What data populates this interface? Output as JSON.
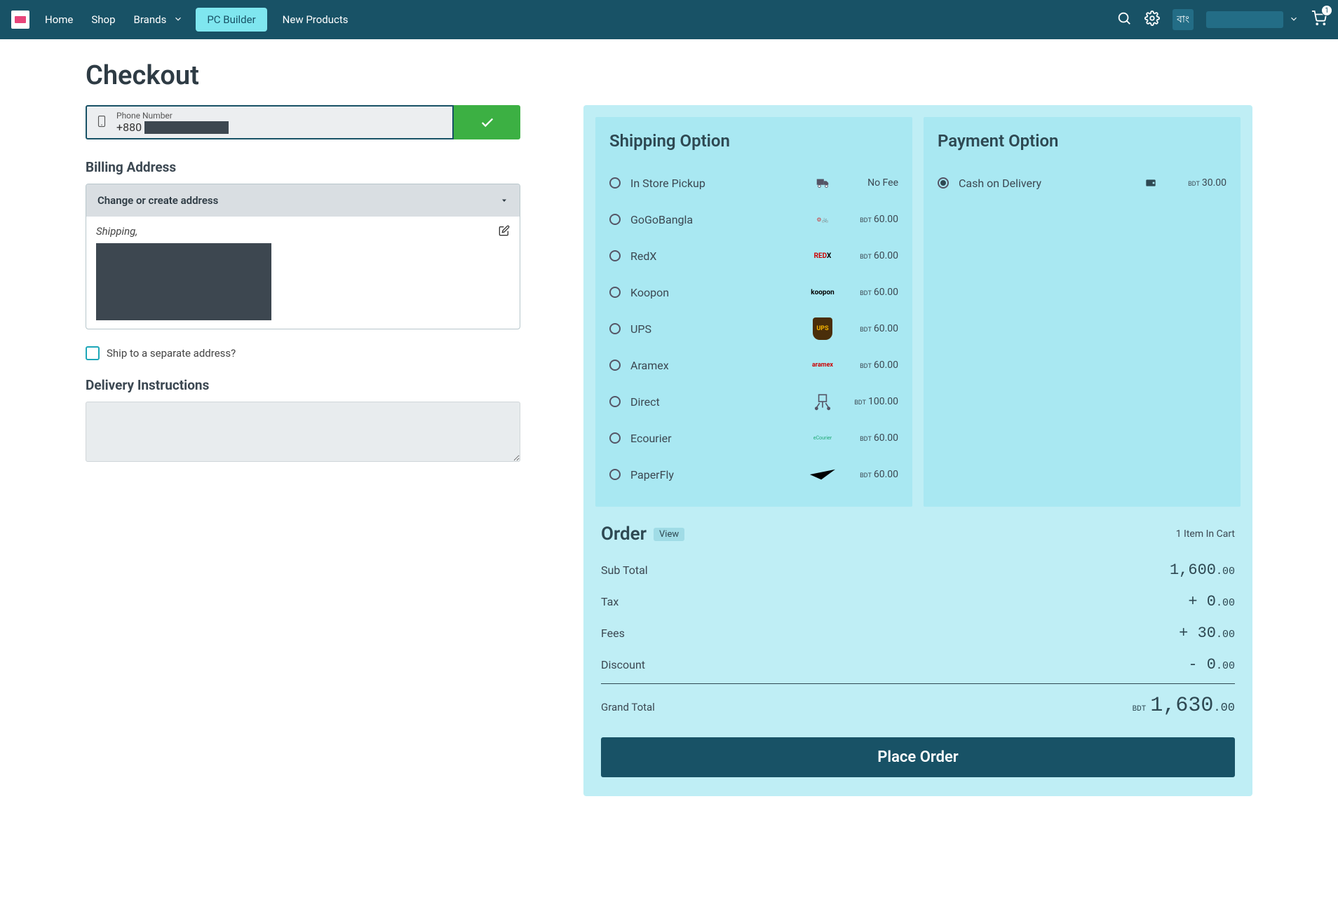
{
  "header": {
    "nav": {
      "home": "Home",
      "shop": "Shop",
      "brands": "Brands",
      "pc_builder": "PC Builder",
      "new_products": "New Products"
    },
    "lang": "বাং",
    "cart_count": "1"
  },
  "page": {
    "title": "Checkout",
    "phone": {
      "label": "Phone Number",
      "prefix": "+880"
    },
    "billing": {
      "heading": "Billing Address",
      "select_label": "Change or create address",
      "addr_type": "Shipping,"
    },
    "ship_separate": "Ship to a separate address?",
    "delivery_instr": "Delivery Instructions"
  },
  "shipping": {
    "title": "Shipping Option",
    "no_fee": "No Fee",
    "currency": "BDT",
    "options": [
      {
        "name": "In Store Pickup",
        "price": "",
        "nofee": true,
        "icon": "truck"
      },
      {
        "name": "GoGoBangla",
        "price": "60.00",
        "icon": "gogo"
      },
      {
        "name": "RedX",
        "price": "60.00",
        "icon": "redx"
      },
      {
        "name": "Koopon",
        "price": "60.00",
        "icon": "koopon"
      },
      {
        "name": "UPS",
        "price": "60.00",
        "icon": "ups"
      },
      {
        "name": "Aramex",
        "price": "60.00",
        "icon": "aramex"
      },
      {
        "name": "Direct",
        "price": "100.00",
        "icon": "hand"
      },
      {
        "name": "Ecourier",
        "price": "60.00",
        "icon": "ecourier"
      },
      {
        "name": "PaperFly",
        "price": "60.00",
        "icon": "paper"
      }
    ]
  },
  "payment": {
    "title": "Payment Option",
    "currency": "BDT",
    "options": [
      {
        "name": "Cash on Delivery",
        "price": "30.00",
        "checked": true
      }
    ]
  },
  "order": {
    "title": "Order",
    "view": "View",
    "count_text": "1 Item In Cart",
    "lines": {
      "subtotal": {
        "label": "Sub Total",
        "int": "1,600",
        "dec": ".00"
      },
      "tax": {
        "label": "Tax",
        "int": "+ 0",
        "dec": ".00"
      },
      "fees": {
        "label": "Fees",
        "int": "+ 30",
        "dec": ".00"
      },
      "discount": {
        "label": "Discount",
        "int": "- 0",
        "dec": ".00"
      }
    },
    "grand": {
      "label": "Grand Total",
      "currency": "BDT",
      "int": "1,630",
      "dec": ".00"
    },
    "place_btn": "Place Order"
  }
}
